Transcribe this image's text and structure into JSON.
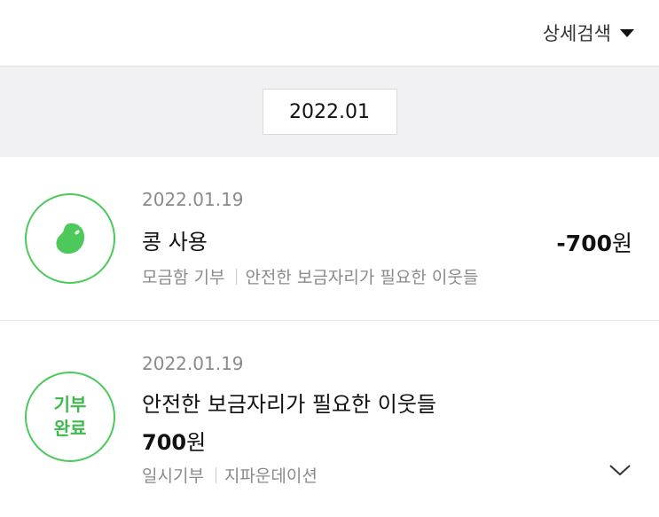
{
  "header": {
    "detail_search_label": "상세검색"
  },
  "month_selector": {
    "value": "2022.01"
  },
  "entries": [
    {
      "date": "2022.01.19",
      "title": "콩 사용",
      "amount_number": "-700",
      "amount_unit": "원",
      "meta_left": "모금함 기부",
      "meta_right": "안전한 보금자리가 필요한 이웃들",
      "icon": "bean-icon",
      "accent_color": "#4cc95a"
    },
    {
      "date": "2022.01.19",
      "badge_line1": "기부",
      "badge_line2": "완료",
      "title": "안전한 보금자리가 필요한 이웃들",
      "amount_number": "700",
      "amount_unit": "원",
      "meta_left": "일시기부",
      "meta_right": "지파운데이션",
      "icon": "chevron-down-icon",
      "accent_color": "#3fb94d"
    }
  ]
}
